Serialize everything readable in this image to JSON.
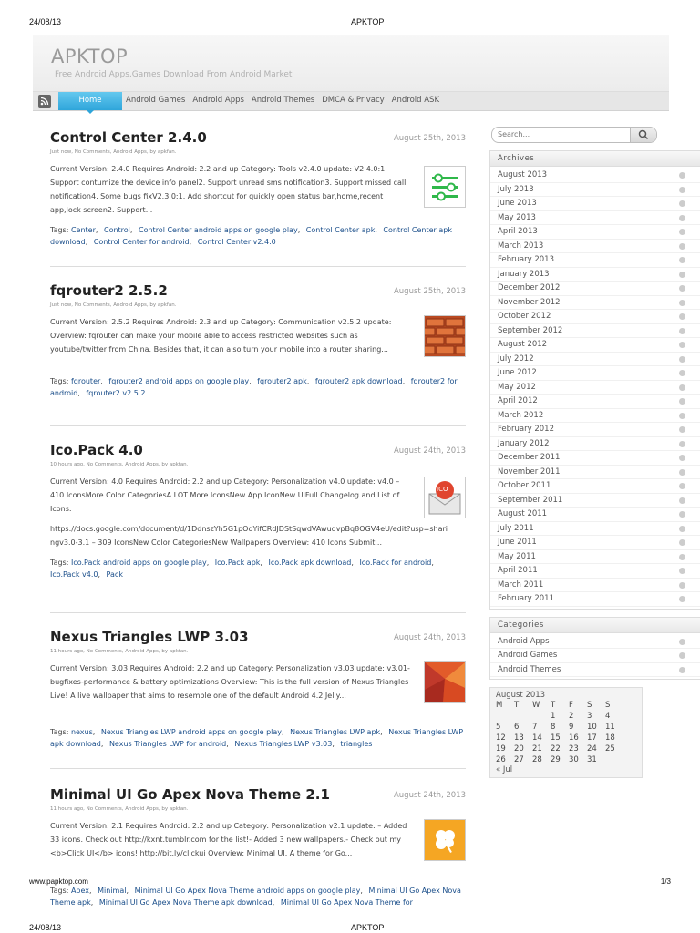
{
  "print": {
    "date": "24/08/13",
    "title": "APKTOP",
    "url": "www.papktop.com",
    "page": "1/3"
  },
  "site": {
    "logo": "APKTOP",
    "tagline": "Free Android Apps,Games Download From Android Market"
  },
  "nav": [
    "Home",
    "Android Games",
    "Android Apps",
    "Android Themes",
    "DMCA & Privacy",
    "Android ASK"
  ],
  "posts": [
    {
      "title": "Control Center 2.4.0",
      "date": "August 25th, 2013",
      "meta": "Just now, No Comments, Android Apps, by apkfan.",
      "body": "Current Version: 2.4.0 Requires Android: 2.2 and up Category: Tools v2.4.0 update: V2.4.0:1. Support contumize the device info panel2. Support unread sms notification3. Support missed call notification4. Some bugs fixV2.3.0:1. Add shortcut for quickly open status bar,home,recent app,lock screen2. Support...",
      "thumb_icon": "sliders-icon",
      "tags": [
        "Center",
        "Control",
        "Control Center android apps on google play",
        "Control Center apk",
        "Control Center apk download",
        "Control Center for android",
        "Control Center v2.4.0"
      ]
    },
    {
      "title": "fqrouter2 2.5.2",
      "date": "August 25th, 2013",
      "meta": "Just now, No Comments, Android Apps, by apkfan.",
      "body": "Current Version: 2.5.2 Requires Android: 2.3 and up Category: Communication v2.5.2 update: Overview: fqrouter can make your mobile able to access restricted websites such as youtube/twitter from China. Besides that, it can also turn your mobile into a router sharing...",
      "thumb_icon": "brick-wall-icon",
      "tags": [
        "fqrouter",
        "fqrouter2 android apps on google play",
        "fqrouter2 apk",
        "fqrouter2 apk download",
        "fqrouter2 for android",
        "fqrouter2 v2.5.2"
      ]
    },
    {
      "title": "Ico.Pack 4.0",
      "date": "August 24th, 2013",
      "meta": "10 hours ago, No Comments, Android Apps, by apkfan.",
      "body": "Current Version: 4.0 Requires Android: 2.2 and up Category: Personalization v4.0 update: v4.0 – 410 IconsMore Color CategoriesA LOT More IconsNew App IconNew UIFull Changelog and List of Icons:",
      "body2": "https://docs.google.com/document/d/1DdnszYh5G1pOqYifCRdJDStSqwdVAwudvpBq8OGV4eU/edit?usp=sharingv3.0-3.1 – 309 IconsNew Color CategoriesNew Wallpapers Overview: 410 Icons Submit...",
      "thumb_icon": "ico-envelope-icon",
      "thumb_text": "ICO",
      "tags": [
        "Ico.Pack android apps on google play",
        "Ico.Pack apk",
        "Ico.Pack apk download",
        "Ico.Pack for android",
        "Ico.Pack v4.0",
        "Pack"
      ]
    },
    {
      "title": "Nexus Triangles LWP 3.03",
      "date": "August 24th, 2013",
      "meta": "11 hours ago, No Comments, Android Apps, by apkfan.",
      "body": "Current Version: 3.03 Requires Android: 2.2 and up Category: Personalization v3.03 update: v3.01-bugfixes-performance & battery optimizations Overview: This is the full version of Nexus Triangles Live! A live wallpaper that aims to resemble one of the default Android 4.2 Jelly...",
      "thumb_icon": "triangles-icon",
      "tags": [
        "nexus",
        "Nexus Triangles LWP android apps on google play",
        "Nexus Triangles LWP apk",
        "Nexus Triangles LWP apk download",
        "Nexus Triangles LWP for android",
        "Nexus Triangles LWP v3.03",
        "triangles"
      ]
    },
    {
      "title": "Minimal UI Go Apex Nova Theme 2.1",
      "date": "August 24th, 2013",
      "meta": "11 hours ago, No Comments, Android Apps, by apkfan.",
      "body": "Current Version: 2.1 Requires Android: 2.2 and up Category: Personalization v2.1 update: – Added 33 icons. Check out http://kxnt.tumblr.com for the list!- Added 3 new wallpapers.- Check out my <b>Click UI</b> icons! http://bit.ly/clickui Overview: Minimal UI. A theme for Go...",
      "thumb_icon": "clover-icon",
      "tags": [
        "Apex",
        "Minimal",
        "Minimal UI Go Apex Nova Theme android apps on google play",
        "Minimal UI Go Apex Nova Theme apk",
        "Minimal UI Go Apex Nova Theme apk download",
        "Minimal UI Go Apex Nova Theme for"
      ]
    }
  ],
  "tags_label": "Tags:",
  "sidebar": {
    "search_placeholder": "Search...",
    "archives_title": "Archives",
    "archives": [
      "August 2013",
      "July 2013",
      "June 2013",
      "May 2013",
      "April 2013",
      "March 2013",
      "February 2013",
      "January 2013",
      "December 2012",
      "November 2012",
      "October 2012",
      "September 2012",
      "August 2012",
      "July 2012",
      "June 2012",
      "May 2012",
      "April 2012",
      "March 2012",
      "February 2012",
      "January 2012",
      "December 2011",
      "November 2011",
      "October 2011",
      "September 2011",
      "August 2011",
      "July 2011",
      "June 2011",
      "May 2011",
      "April 2011",
      "March 2011",
      "February 2011"
    ],
    "categories_title": "Categories",
    "categories": [
      "Android Apps",
      "Android Games",
      "Android Themes"
    ],
    "calendar": {
      "caption": "August 2013",
      "days": [
        "M",
        "T",
        "W",
        "T",
        "F",
        "S",
        "S"
      ],
      "weeks": [
        [
          "",
          "",
          "",
          "1",
          "2",
          "3",
          "4"
        ],
        [
          "5",
          "6",
          "7",
          "8",
          "9",
          "10",
          "11"
        ],
        [
          "12",
          "13",
          "14",
          "15",
          "16",
          "17",
          "18"
        ],
        [
          "19",
          "20",
          "21",
          "22",
          "23",
          "24",
          "25"
        ],
        [
          "26",
          "27",
          "28",
          "29",
          "30",
          "31",
          ""
        ]
      ],
      "prev": "« Jul"
    }
  },
  "colors": {
    "nav_active": "#2ea5da",
    "link": "#1a4e8a",
    "title": "#222222"
  }
}
